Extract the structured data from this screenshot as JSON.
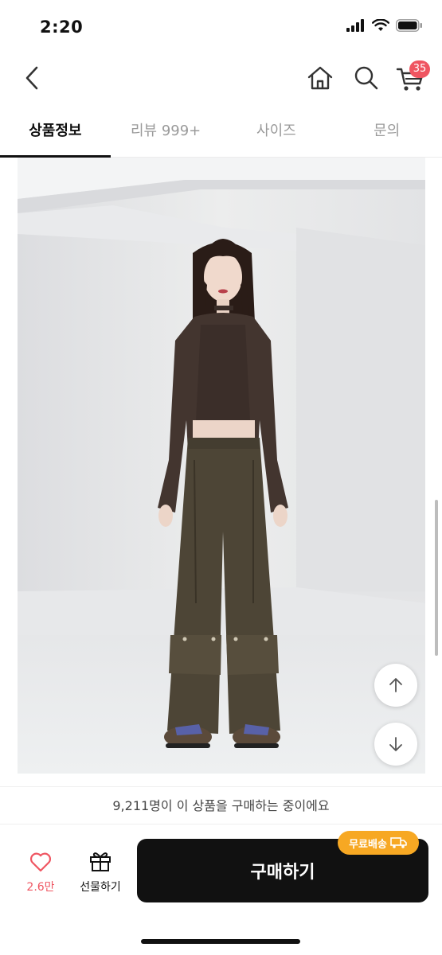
{
  "status_bar": {
    "time": "2:20"
  },
  "nav": {
    "cart_count": "35"
  },
  "tabs": [
    {
      "label": "상품정보",
      "active": true
    },
    {
      "label": "리뷰 999+",
      "active": false
    },
    {
      "label": "사이즈",
      "active": false
    },
    {
      "label": "문의",
      "active": false
    }
  ],
  "product": {
    "purchase_info": "9,211명이 이 상품을 구매하는 중이에요"
  },
  "bottom_bar": {
    "like_count": "2.6만",
    "gift_label": "선물하기",
    "buy_label": "구매하기",
    "free_shipping_label": "무료배송"
  },
  "colors": {
    "accent_red": "#ef5561",
    "badge_orange": "#f7a823",
    "button_black": "#111111"
  }
}
